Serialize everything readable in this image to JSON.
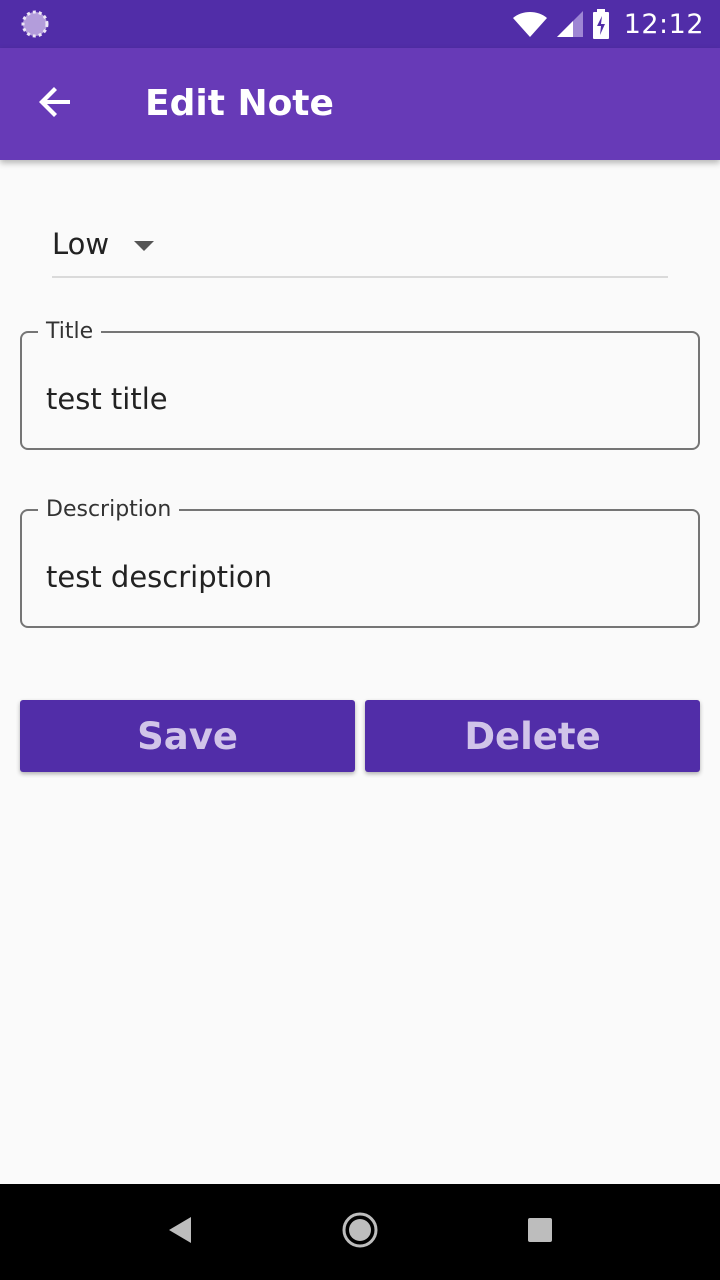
{
  "status_bar": {
    "time": "12:12",
    "icons": [
      "sync-icon",
      "wifi-icon",
      "signal-icon",
      "battery-charging-icon"
    ]
  },
  "app_bar": {
    "back_icon": "arrow-back-icon",
    "title": "Edit Note"
  },
  "priority_dropdown": {
    "selected": "Low",
    "arrow_icon": "arrow-drop-down-icon"
  },
  "title_field": {
    "label": "Title",
    "value": "test title"
  },
  "description_field": {
    "label": "Description",
    "value": "test description"
  },
  "actions": {
    "save_label": "Save",
    "delete_label": "Delete"
  },
  "nav_bar": {
    "icons": [
      "nav-back-icon",
      "nav-home-icon",
      "nav-recents-icon"
    ]
  },
  "colors": {
    "status_bar": "#512DA8",
    "app_bar": "#673AB7",
    "button_bg": "#512DA8",
    "button_text": "#D1C4E9",
    "background": "#FAFAFA",
    "nav_bar": "#000000"
  }
}
